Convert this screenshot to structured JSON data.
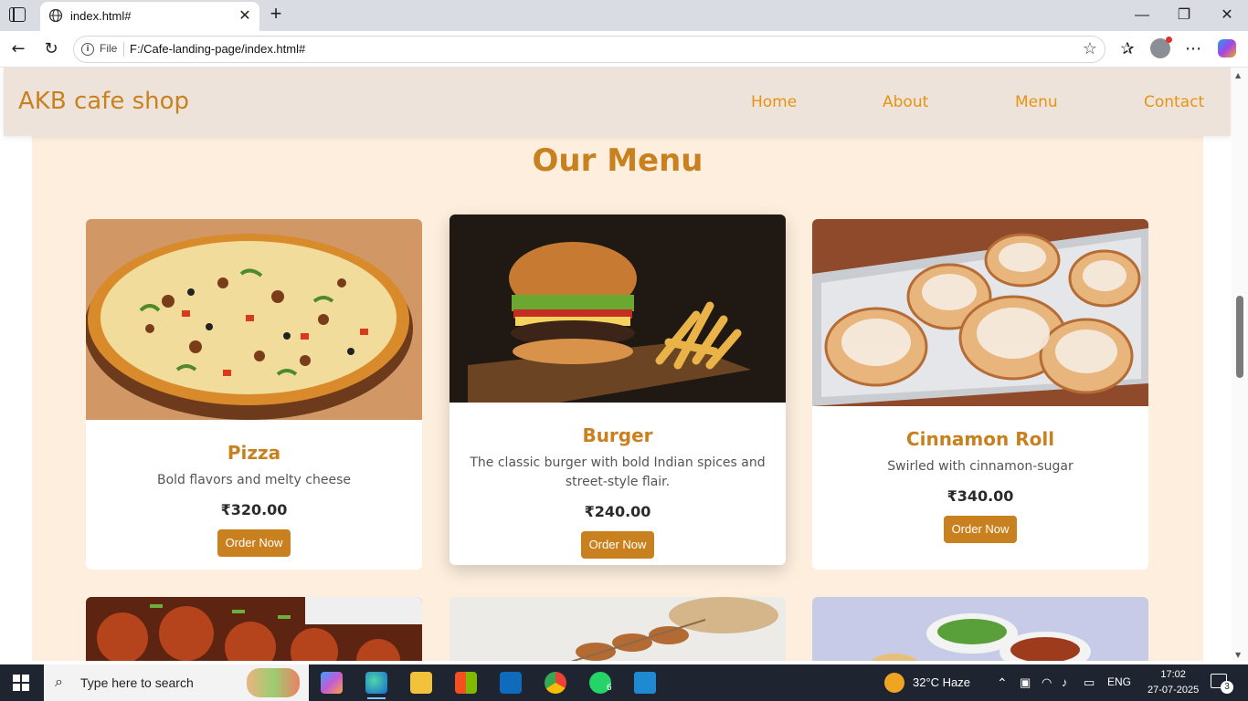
{
  "browser": {
    "tab_title": "index.html#",
    "address_prefix": "File",
    "url": "F:/Cafe-landing-page/index.html#"
  },
  "site": {
    "brand": "AKB cafe shop",
    "nav": [
      {
        "label": "Home"
      },
      {
        "label": "About"
      },
      {
        "label": "Menu"
      },
      {
        "label": "Contact"
      }
    ],
    "section_title": "Our Menu",
    "items": [
      {
        "name": "Pizza",
        "description": "Bold flavors and melty cheese",
        "price": "₹320.00",
        "button": "Order Now"
      },
      {
        "name": "Burger",
        "description": "The classic burger with bold Indian spices and street-style flair.",
        "price": "₹240.00",
        "button": "Order Now"
      },
      {
        "name": "Cinnamon Roll",
        "description": "Swirled with cinnamon-sugar",
        "price": "₹340.00",
        "button": "Order Now"
      }
    ]
  },
  "taskbar": {
    "search_placeholder": "Type here to search",
    "weather": "32°C  Haze",
    "language": "ENG",
    "time": "17:02",
    "date": "27-07-2025",
    "whatsapp_badge": "6",
    "notification_count": "3"
  },
  "colors": {
    "accent": "#c98120",
    "nav_link": "#e69412",
    "section_bg": "#fdeedd",
    "navbar_bg": "#ede3db"
  }
}
